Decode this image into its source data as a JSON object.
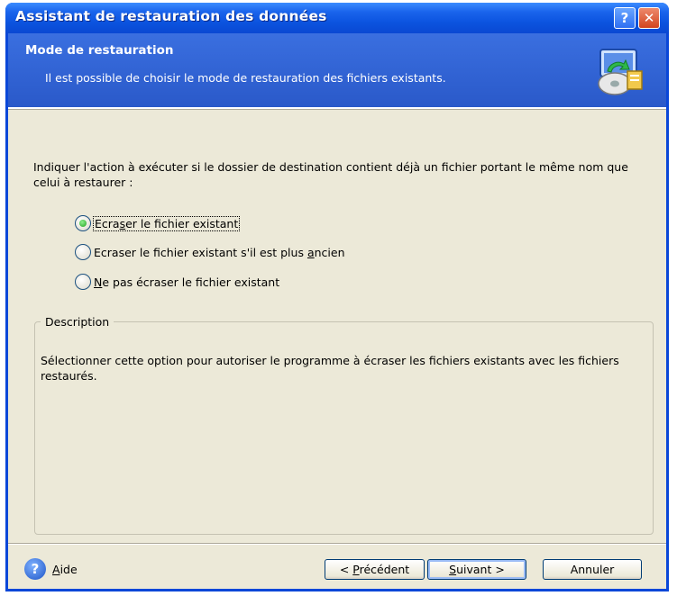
{
  "window": {
    "title": "Assistant de restauration des données",
    "help_btn": "?",
    "close_btn": "✕"
  },
  "header": {
    "title": "Mode de restauration",
    "description": "Il est possible de choisir le mode de restauration des fichiers existants."
  },
  "prompt": "Indiquer l'action à exécuter si le dossier de destination contient déjà un fichier portant le même nom que celui à restaurer :",
  "options": [
    {
      "pre": "Ecra",
      "ul": "s",
      "post": "er le fichier existant",
      "selected": true
    },
    {
      "pre": "Ecraser le fichier existant s'il est plus ",
      "ul": "a",
      "post": "ncien",
      "selected": false
    },
    {
      "pre": "",
      "ul": "N",
      "post": "e pas écraser le fichier existant",
      "selected": false
    }
  ],
  "description_group": {
    "legend": "Description",
    "text": "Sélectionner cette option pour autoriser le programme à écraser les fichiers existants avec les fichiers restaurés."
  },
  "footer": {
    "help_icon": "?",
    "help": {
      "ul": "A",
      "post": "ide"
    },
    "prev": {
      "pre": "< ",
      "ul": "P",
      "post": "récédent"
    },
    "next": {
      "ul": "S",
      "post": "uivant >"
    },
    "cancel": "Annuler"
  },
  "icons": {
    "header_icon": "restore-wizard-icon",
    "help_icon": "help-icon"
  },
  "colors": {
    "titlebar": "#0b53df",
    "header": "#3a6fe0",
    "client": "#ece9d8",
    "radio_checked": "#21a121"
  }
}
